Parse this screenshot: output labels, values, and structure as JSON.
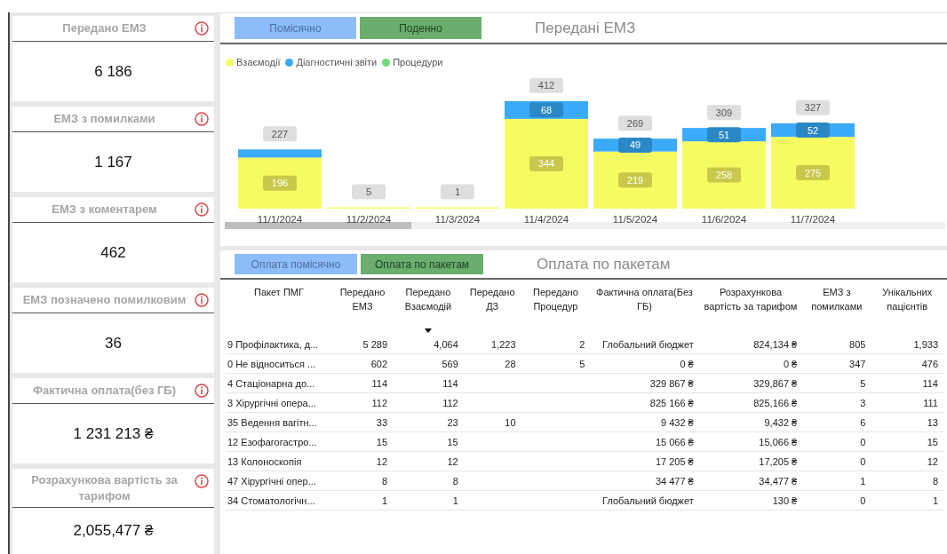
{
  "kpi_cards": [
    {
      "title": "Передано ЕМЗ",
      "value": "6 186"
    },
    {
      "title": "ЕМЗ з помилками",
      "value": "1 167"
    },
    {
      "title": "ЕМЗ з коментарем",
      "value": "462"
    },
    {
      "title": "ЕМЗ позначено помилковим",
      "value": "36"
    },
    {
      "title": "Фактична оплата(без ГБ)",
      "value": "1 231 213 ₴"
    },
    {
      "title": "Розрахункова вартість за тарифом",
      "value": "2,055,477 ₴"
    }
  ],
  "chart_panel": {
    "buttons": [
      "Помісячно",
      "Поденно"
    ],
    "title": "Передані ЕМЗ",
    "chart_data": {
      "type": "bar",
      "stacked": true,
      "annotations": [
        "227",
        "5",
        "1",
        "412",
        "269",
        "309",
        "327"
      ],
      "categories": [
        "11/1/2024",
        "11/2/2024",
        "11/3/2024",
        "11/4/2024",
        "11/5/2024",
        "11/6/2024",
        "11/7/2024"
      ],
      "series": [
        {
          "name": "Взаємодії",
          "color": "#f7fb62",
          "values": [
            196,
            5,
            1,
            344,
            219,
            258,
            275
          ],
          "value_labels": [
            "196",
            null,
            null,
            "344",
            "219",
            "258",
            "275"
          ]
        },
        {
          "name": "Діагностичні звіти",
          "color": "#3aaaf9",
          "values": [
            31,
            0,
            0,
            68,
            49,
            51,
            52
          ],
          "value_labels": [
            null,
            null,
            null,
            "68",
            "49",
            "51",
            "52"
          ]
        },
        {
          "name": "Процедури",
          "color": "#6ed97a",
          "values": [
            0,
            0,
            0,
            0,
            0,
            0,
            0
          ],
          "value_labels": [
            null,
            null,
            null,
            null,
            null,
            null,
            null
          ]
        }
      ]
    }
  },
  "table_panel": {
    "buttons": [
      "Оплата помісячно",
      "Оплата по пакетам"
    ],
    "title": "Оплата по пакетам",
    "columns": [
      {
        "label": "Пакет ПМГ",
        "sorted": false
      },
      {
        "label": "Передано ЕМЗ",
        "sorted": false
      },
      {
        "label": "Передано Взаємодій",
        "sorted": true
      },
      {
        "label": "Передано ДЗ",
        "sorted": false
      },
      {
        "label": "Передано Процедур",
        "sorted": false
      },
      {
        "label": "Фактична оплата(Без ГБ)",
        "sorted": false
      },
      {
        "label": "Розрахункова вартість за тарифом",
        "sorted": false
      },
      {
        "label": "ЕМЗ з помилками",
        "sorted": false
      },
      {
        "label": "Унікальних пацієнтів",
        "sorted": false
      }
    ],
    "rows": [
      [
        "9 Профілактика, д...",
        "5 289",
        "4,064",
        "1,223",
        "2",
        "Глобальний бюджет",
        "824,134 ₴",
        "805",
        "1,933"
      ],
      [
        "0 Не відноситься ...",
        "602",
        "569",
        "28",
        "5",
        "0 ₴",
        "0 ₴",
        "347",
        "476"
      ],
      [
        "4 Стаціонарна до...",
        "114",
        "114",
        "",
        "",
        "329 867 ₴",
        "329,867 ₴",
        "5",
        "114"
      ],
      [
        "3 Хірургічні опера...",
        "112",
        "112",
        "",
        "",
        "825 166 ₴",
        "825,166 ₴",
        "3",
        "111"
      ],
      [
        "35 Ведення вагітн...",
        "33",
        "23",
        "10",
        "",
        "9 432 ₴",
        "9,432 ₴",
        "6",
        "13"
      ],
      [
        "12 Езофагогастро...",
        "15",
        "15",
        "",
        "",
        "15 066 ₴",
        "15,066 ₴",
        "0",
        "15"
      ],
      [
        "13 Колоноскопія",
        "12",
        "12",
        "",
        "",
        "17 205 ₴",
        "17,205 ₴",
        "0",
        "12"
      ],
      [
        "47 Хірургічні опер...",
        "8",
        "8",
        "",
        "",
        "34 477 ₴",
        "34,477 ₴",
        "1",
        "8"
      ],
      [
        "34 Стоматологічн...",
        "1",
        "1",
        "",
        "",
        "Глобальний бюджет",
        "130 ₴",
        "0",
        "1"
      ]
    ]
  }
}
